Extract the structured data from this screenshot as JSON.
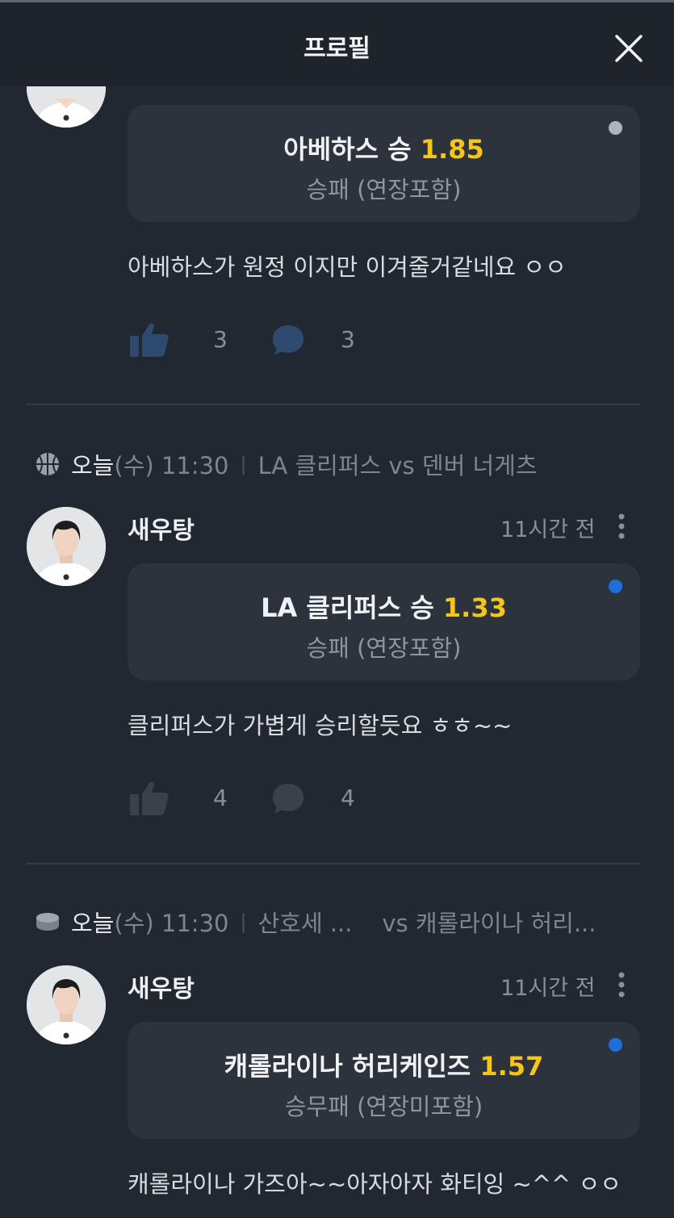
{
  "header": {
    "title": "프로필"
  },
  "posts": [
    {
      "bet": {
        "selection": "아베하스 승",
        "odds": "1.85",
        "market": "승패 (연장포함)",
        "status_color": "#b0b3b8"
      },
      "comment": "아베하스가 원정 이지만 이겨줄거같네요 ㅇㅇ",
      "likes": "3",
      "replies": "3"
    },
    {
      "match": {
        "sport_icon": "basketball-icon",
        "day": "오늘",
        "weekday_time": "(수) 11:30",
        "teams": "LA 클리퍼스 vs 덴버 너게츠"
      },
      "user": "새우탕",
      "time_ago": "11시간 전",
      "bet": {
        "selection": "LA 클리퍼스 승",
        "odds": "1.33",
        "market": "승패 (연장포함)",
        "status_color": "#1e6fd9"
      },
      "comment": "클리퍼스가 가볍게 승리할듯요 ㅎㅎ~~",
      "likes": "4",
      "replies": "4"
    },
    {
      "match": {
        "sport_icon": "hockey-puck-icon",
        "day": "오늘",
        "weekday_time": "(수) 11:30",
        "teams": "산호세 ...    vs 캐롤라이나 허리..."
      },
      "user": "새우탕",
      "time_ago": "11시간 전",
      "bet": {
        "selection": "캐롤라이나 허리케인즈",
        "odds": "1.57",
        "market": "승무패 (연장미포함)",
        "status_color": "#1e6fd9"
      },
      "comment": "캐롤라이나 가즈아~~아자아자 화티잉 ~^^ ㅇㅇ"
    }
  ]
}
